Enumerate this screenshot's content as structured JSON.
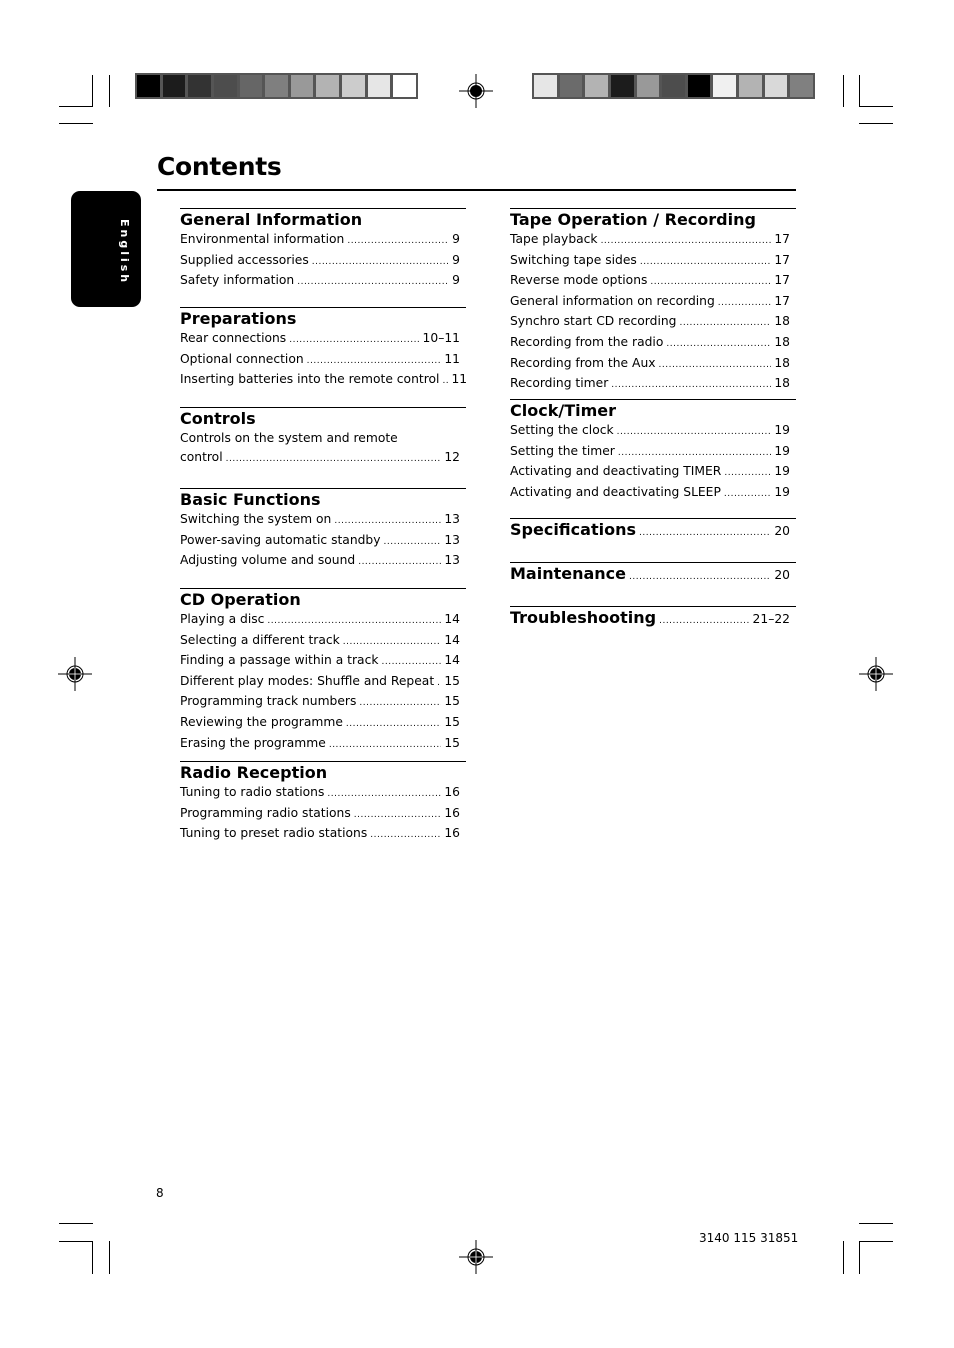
{
  "document": {
    "title": "Contents",
    "language_tab": "English",
    "page_number": "8",
    "product_code": "3140 115 31851"
  },
  "print_marks": {
    "left_colorbar": [
      "#000000",
      "#1c1c1c",
      "#333333",
      "#4d4d4d",
      "#666666",
      "#7f7f7f",
      "#999999",
      "#b3b3b3",
      "#cccccc",
      "#e6e6e6",
      "#ffffff"
    ],
    "right_colorbar": [
      "#e6e6e6",
      "#6b6b6b",
      "#b3b3b3",
      "#1c1c1c",
      "#999999",
      "#4d4d4d",
      "#000000",
      "#f0f0f0",
      "#b3b3b3",
      "#d9d9d9",
      "#808080"
    ]
  },
  "toc": {
    "left": [
      {
        "title": "General Information",
        "entries": [
          {
            "label": "Environmental information",
            "page": "9"
          },
          {
            "label": "Supplied accessories",
            "page": "9"
          },
          {
            "label": "Safety information",
            "page": "9"
          }
        ]
      },
      {
        "title": "Preparations",
        "entries": [
          {
            "label": "Rear connections",
            "page": "10–11"
          },
          {
            "label": "Optional connection",
            "page": "11"
          },
          {
            "label": "Inserting batteries into the remote control",
            "page": "11"
          }
        ]
      },
      {
        "title": "Controls",
        "entries": [
          {
            "label_line1": "Controls on the system and remote",
            "label": "control",
            "page": "12"
          }
        ]
      },
      {
        "title": "Basic Functions",
        "entries": [
          {
            "label": "Switching the system on",
            "page": "13"
          },
          {
            "label": "Power-saving automatic standby",
            "page": "13"
          },
          {
            "label": "Adjusting volume and sound",
            "page": "13"
          }
        ]
      },
      {
        "title": "CD Operation",
        "entries": [
          {
            "label": "Playing a disc",
            "page": "14"
          },
          {
            "label": "Selecting a different track",
            "page": "14"
          },
          {
            "label": "Finding a passage within a track",
            "page": "14"
          },
          {
            "label": "Different play modes: Shuffle and Repeat",
            "page": "15"
          },
          {
            "label": "Programming track numbers",
            "page": "15"
          },
          {
            "label": "Reviewing the programme",
            "page": "15"
          },
          {
            "label": "Erasing the programme",
            "page": "15"
          }
        ]
      },
      {
        "title": "Radio Reception",
        "entries": [
          {
            "label": "Tuning to radio stations",
            "page": "16"
          },
          {
            "label": "Programming radio stations",
            "page": "16"
          },
          {
            "label": "Tuning to preset radio stations",
            "page": "16"
          }
        ]
      }
    ],
    "right": [
      {
        "title": "Tape Operation / Recording",
        "entries": [
          {
            "label": "Tape playback",
            "page": "17"
          },
          {
            "label": "Switching tape sides",
            "page": "17"
          },
          {
            "label": "Reverse mode options",
            "page": "17"
          },
          {
            "label": "General information on recording",
            "page": "17"
          },
          {
            "label": "Synchro start CD recording",
            "page": "18"
          },
          {
            "label": "Recording from the radio",
            "page": "18"
          },
          {
            "label": "Recording from the Aux",
            "page": "18"
          },
          {
            "label": "Recording timer",
            "page": "18"
          }
        ]
      },
      {
        "title": "Clock/Timer",
        "entries": [
          {
            "label": "Setting the clock",
            "page": "19"
          },
          {
            "label": "Setting the timer",
            "page": "19"
          },
          {
            "label": "Activating and deactivating TIMER",
            "page": "19"
          },
          {
            "label": "Activating and deactivating SLEEP",
            "page": "19"
          }
        ]
      },
      {
        "title": "Specifications",
        "page": "20"
      },
      {
        "title": "Maintenance",
        "page": "20"
      },
      {
        "title": "Troubleshooting",
        "page": "21–22"
      }
    ]
  }
}
